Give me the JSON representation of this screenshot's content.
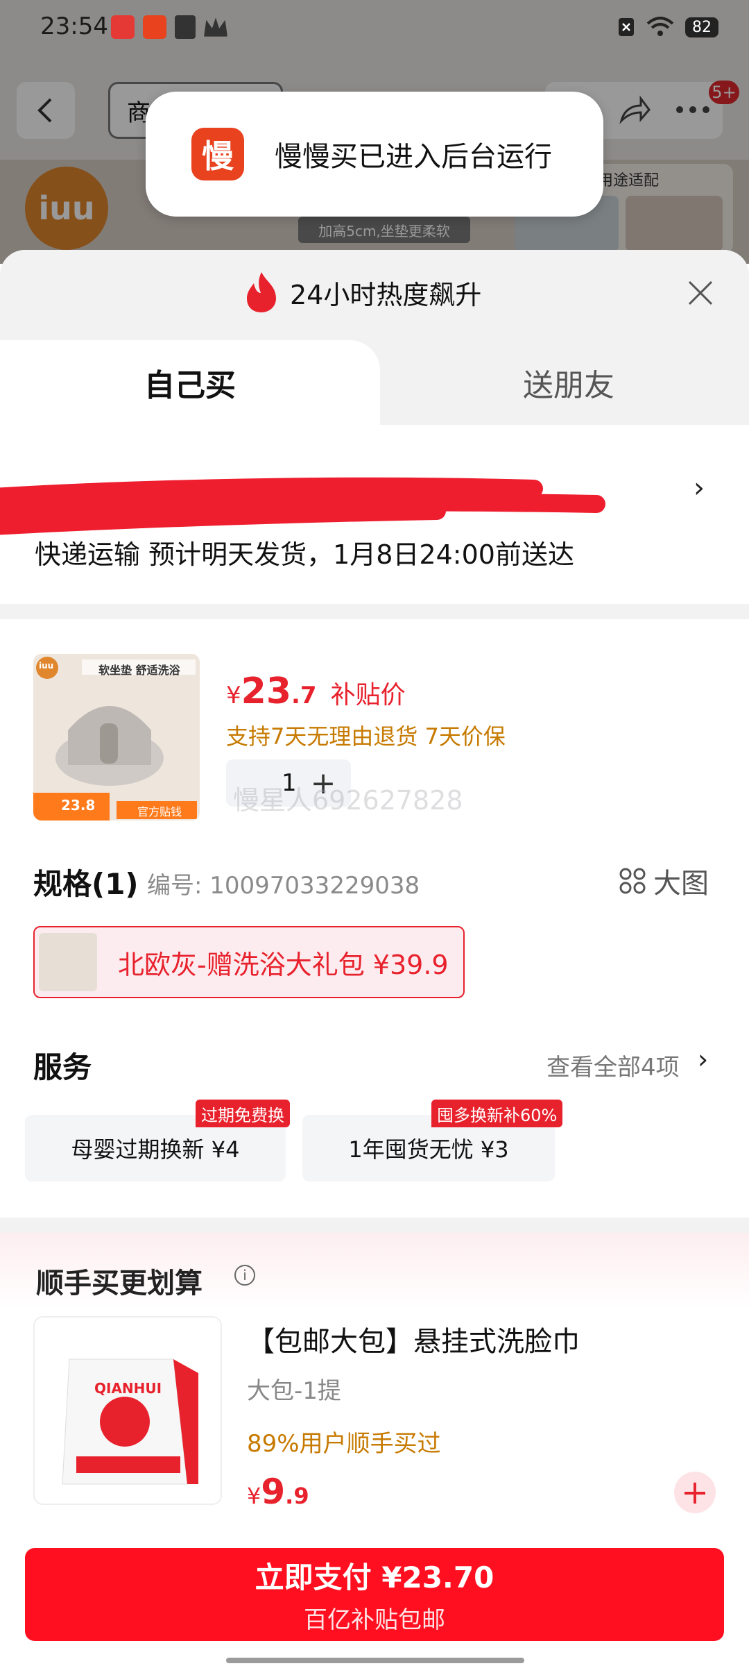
{
  "status_bar": {
    "time": "23:54",
    "battery": "82"
  },
  "background_page": {
    "search_text": "商",
    "cart_badge": "5+",
    "brand_logo": "iuu",
    "banner_strip": "加高5cm,坐垫更柔软",
    "right_card_label": "用途适配"
  },
  "toast": {
    "app_icon_char": "慢",
    "message": "慢慢买已进入后台运行"
  },
  "sheet": {
    "header": "24小时热度飙升",
    "tabs": {
      "self": "自己买",
      "gift": "送朋友"
    },
    "address_arrow": "›",
    "delivery": "快递运输 预计明天发货，1月8日24:00前送达"
  },
  "product": {
    "price_yen": "¥",
    "price_int": "23",
    "price_dec": ".7",
    "price_tag": "补贴价",
    "guarantee": "支持7天无理由退货 7天价保",
    "quantity": "1",
    "watermark": "慢星人692627828",
    "image_text": {
      "title": "软坐垫 舒适洗浴",
      "brand": "iuu",
      "price": "23.8",
      "official": "官方贴钱"
    }
  },
  "spec": {
    "title": "规格(1)",
    "code": "编号: 10097033229038",
    "big_view": "大图",
    "selected_option": "北欧灰-赠洗浴大礼包 ¥39.9"
  },
  "services": {
    "title": "服务",
    "see_all": "查看全部4项",
    "items": [
      {
        "label": "母婴过期换新 ¥4",
        "badge": "过期免费换"
      },
      {
        "label": "1年囤货无忧 ¥3",
        "badge": "囤多换新补60%"
      }
    ]
  },
  "addon": {
    "title": "顺手买更划算",
    "name": "【包邮大包】悬挂式洗脸巾",
    "spec": "大包-1提",
    "social": "89%用户顺手买过",
    "price_yen": "¥",
    "price_int": "9",
    "price_dec": ".9",
    "image_brand": "QIANHUI"
  },
  "pay": {
    "main": "立即支付 ¥23.70",
    "sub": "百亿补贴包邮"
  },
  "colors": {
    "accent_red": "#e8222d",
    "pay_red": "#ff0f1f",
    "warn_orange": "#c77a00"
  }
}
